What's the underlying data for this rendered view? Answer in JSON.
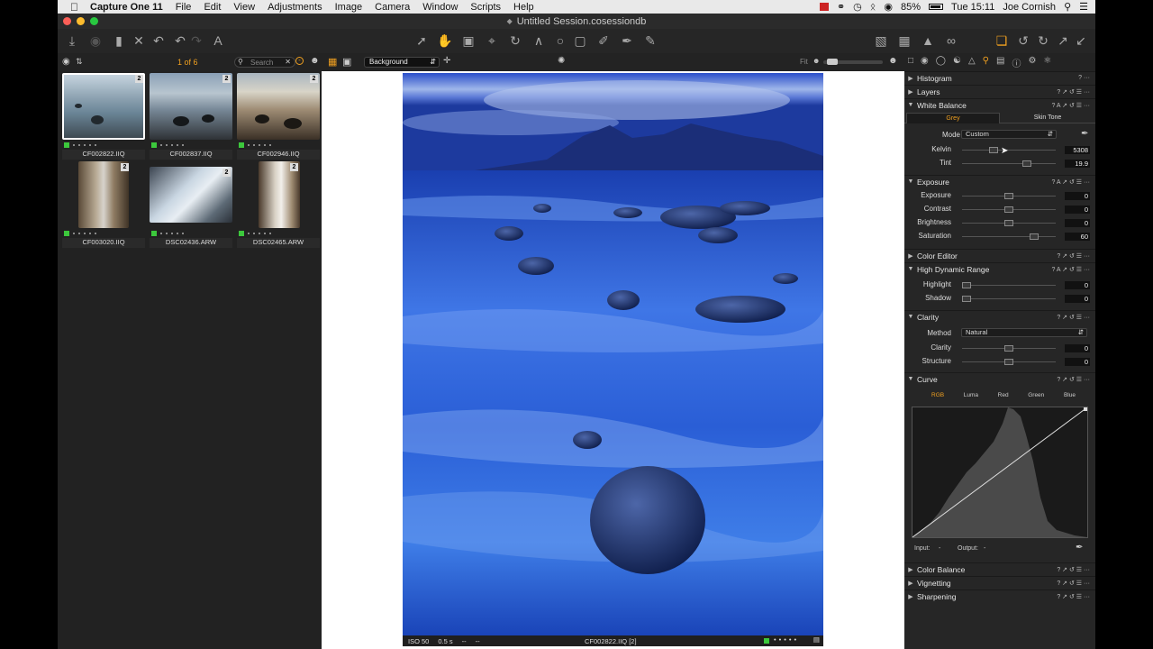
{
  "menubar": {
    "apple": "",
    "app": "Capture One 11",
    "items": [
      "File",
      "Edit",
      "View",
      "Adjustments",
      "Image",
      "Camera",
      "Window",
      "Scripts",
      "Help"
    ],
    "battery": "85%",
    "clock": "Tue 15:11",
    "user": "Joe Cornish"
  },
  "window": {
    "title": "Untitled Session.cosessiondb"
  },
  "browser": {
    "counter": "1 of 6",
    "search_placeholder": "Search",
    "thumbs": [
      {
        "name": "CF002822.IIQ",
        "badge": "2"
      },
      {
        "name": "CF002837.IIQ",
        "badge": "2"
      },
      {
        "name": "CF002946.IIQ",
        "badge": "2"
      },
      {
        "name": "CF003020.IIQ",
        "badge": "2"
      },
      {
        "name": "DSC02436.ARW",
        "badge": "2"
      },
      {
        "name": "DSC02465.ARW",
        "badge": "2"
      }
    ]
  },
  "viewer": {
    "layer": "Background",
    "fit": "Fit",
    "status_left": [
      "ISO 50",
      "0.5 s",
      "--",
      "--"
    ],
    "status_file": "CF002822.IIQ [2]"
  },
  "tools": {
    "histogram": "Histogram",
    "layers": "Layers",
    "white_balance": {
      "title": "White Balance",
      "tabs": [
        "Grey",
        "Skin Tone"
      ],
      "mode_label": "Mode",
      "mode_value": "Custom",
      "kelvin_label": "Kelvin",
      "kelvin_value": "5308",
      "tint_label": "Tint",
      "tint_value": "19.9"
    },
    "exposure": {
      "title": "Exposure",
      "rows": [
        {
          "label": "Exposure",
          "value": "0",
          "pos": 0.5
        },
        {
          "label": "Contrast",
          "value": "0",
          "pos": 0.5
        },
        {
          "label": "Brightness",
          "value": "0",
          "pos": 0.5
        },
        {
          "label": "Saturation",
          "value": "60",
          "pos": 0.8
        }
      ]
    },
    "color_editor": "Color Editor",
    "hdr": {
      "title": "High Dynamic Range",
      "rows": [
        {
          "label": "Highlight",
          "value": "0",
          "pos": 0.0
        },
        {
          "label": "Shadow",
          "value": "0",
          "pos": 0.0
        }
      ]
    },
    "clarity": {
      "title": "Clarity",
      "method_label": "Method",
      "method_value": "Natural",
      "rows": [
        {
          "label": "Clarity",
          "value": "0",
          "pos": 0.5
        },
        {
          "label": "Structure",
          "value": "0",
          "pos": 0.5
        }
      ]
    },
    "curve": {
      "title": "Curve",
      "tabs": [
        "RGB",
        "Luma",
        "Red",
        "Green",
        "Blue"
      ],
      "input_label": "Input:",
      "input_value": "-",
      "output_label": "Output:",
      "output_value": "-"
    },
    "color_balance": "Color Balance",
    "vignetting": "Vignetting",
    "sharpening": "Sharpening"
  },
  "colors": {
    "accent": "#f0a020",
    "green_tag": "#3cc83c",
    "panel": "#262626"
  }
}
